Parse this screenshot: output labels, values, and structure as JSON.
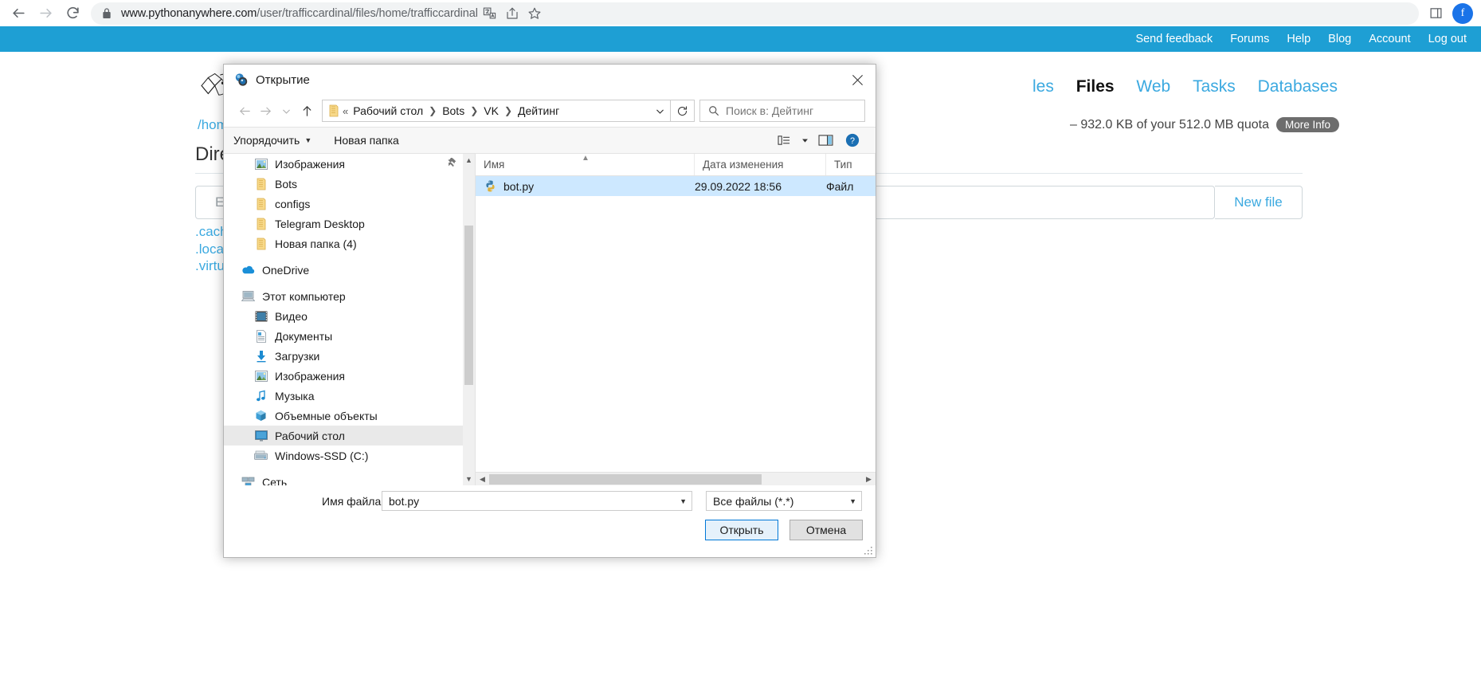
{
  "browser": {
    "back_icon": "arrow-left-icon",
    "forward_icon": "arrow-right-icon",
    "reload_icon": "reload-icon",
    "lock_icon": "lock-icon",
    "url_host": "www.pythonanywhere.com",
    "url_path": "/user/trafficcardinal/files/home/trafficcardinal",
    "url_full": "www.pythonanywhere.com/user/trafficcardinal/files/home/trafficcardinal",
    "translate_icon": "translate-icon",
    "share_icon": "share-icon",
    "bookmark_icon": "star-icon",
    "sidepanel_icon": "side-panel-icon",
    "avatar_letter": "f"
  },
  "pythonanywhere": {
    "topnav": [
      {
        "label": "Send feedback"
      },
      {
        "label": "Forums"
      },
      {
        "label": "Help"
      },
      {
        "label": "Blog"
      },
      {
        "label": "Account"
      },
      {
        "label": "Log out"
      }
    ],
    "wordmark": "p",
    "mainnav": [
      {
        "label": "les",
        "active": false
      },
      {
        "label": "Files",
        "active": true
      },
      {
        "label": "Web",
        "active": false
      },
      {
        "label": "Tasks",
        "active": false
      },
      {
        "label": "Databases",
        "active": false
      }
    ],
    "breadcrumb": "/home/",
    "quota_text": "– 932.0 KB of your 512.0 MB quota",
    "more_info_label": "More Info",
    "directories_heading": "Directorie",
    "new_file_placeholder": "Enter new",
    "new_file_button": "New file",
    "dir_entries": [
      ".cache/",
      ".local/",
      ".virtualenvs"
    ]
  },
  "dialog": {
    "title": "Открытие",
    "title_icon": "app-icon",
    "close_icon": "close-icon",
    "nav": {
      "back_icon": "arrow-left-icon",
      "forward_icon": "arrow-right-icon",
      "history_icon": "chevron-down-icon",
      "up_icon": "arrow-up-icon"
    },
    "address": {
      "folder_icon": "folder-icon",
      "overflow": "«",
      "crumbs": [
        "Рабочий стол",
        "Bots",
        "VK",
        "Дейтинг"
      ],
      "dropdown_icon": "chevron-down-icon",
      "refresh_icon": "refresh-icon"
    },
    "search": {
      "icon": "search-icon",
      "placeholder": "Поиск в: Дейтинг"
    },
    "toolbar": {
      "organize_label": "Упорядочить",
      "new_folder_label": "Новая папка",
      "view_icon": "view-list-icon",
      "view_caret_icon": "chevron-down-icon",
      "preview_icon": "preview-pane-icon",
      "help_icon": "help-icon"
    },
    "sidebar": {
      "pin_icon": "pin-icon",
      "items": [
        {
          "label": "Изображения",
          "icon": "pictures-icon",
          "level": 2,
          "selected": false
        },
        {
          "label": "Bots",
          "icon": "folder-icon",
          "level": 2,
          "selected": false
        },
        {
          "label": "configs",
          "icon": "folder-icon",
          "level": 2,
          "selected": false
        },
        {
          "label": "Telegram Desktop",
          "icon": "folder-icon",
          "level": 2,
          "selected": false
        },
        {
          "label": "Новая папка (4)",
          "icon": "folder-icon",
          "level": 2,
          "selected": false
        },
        {
          "label": "",
          "icon": "spacer",
          "level": 1,
          "selected": false
        },
        {
          "label": "OneDrive",
          "icon": "onedrive-icon",
          "level": 1,
          "selected": false
        },
        {
          "label": "",
          "icon": "spacer",
          "level": 1,
          "selected": false
        },
        {
          "label": "Этот компьютер",
          "icon": "this-pc-icon",
          "level": 1,
          "selected": false
        },
        {
          "label": "Видео",
          "icon": "videos-icon",
          "level": 2,
          "selected": false
        },
        {
          "label": "Документы",
          "icon": "documents-icon",
          "level": 2,
          "selected": false
        },
        {
          "label": "Загрузки",
          "icon": "downloads-icon",
          "level": 2,
          "selected": false
        },
        {
          "label": "Изображения",
          "icon": "pictures-icon",
          "level": 2,
          "selected": false
        },
        {
          "label": "Музыка",
          "icon": "music-icon",
          "level": 2,
          "selected": false
        },
        {
          "label": "Объемные объекты",
          "icon": "3d-objects-icon",
          "level": 2,
          "selected": false
        },
        {
          "label": "Рабочий стол",
          "icon": "desktop-icon",
          "level": 2,
          "selected": true
        },
        {
          "label": "Windows-SSD (C:)",
          "icon": "drive-icon",
          "level": 2,
          "selected": false
        },
        {
          "label": "",
          "icon": "spacer",
          "level": 1,
          "selected": false
        },
        {
          "label": "Сеть",
          "icon": "network-icon",
          "level": 1,
          "selected": false
        }
      ]
    },
    "file_list": {
      "columns": [
        "Имя",
        "Дата изменения",
        "Тип"
      ],
      "sort_marker_icon": "sort-ascending-icon",
      "rows": [
        {
          "name": "bot.py",
          "date": "29.09.2022 18:56",
          "type": "Файл",
          "icon": "python-file-icon",
          "selected": true
        }
      ]
    },
    "footer": {
      "filename_label": "Имя файла:",
      "filename_value": "bot.py",
      "filter_value": "Все файлы (*.*)",
      "open_button": "Открыть",
      "cancel_button": "Отмена",
      "resize_grip_icon": "resize-grip-icon"
    }
  }
}
